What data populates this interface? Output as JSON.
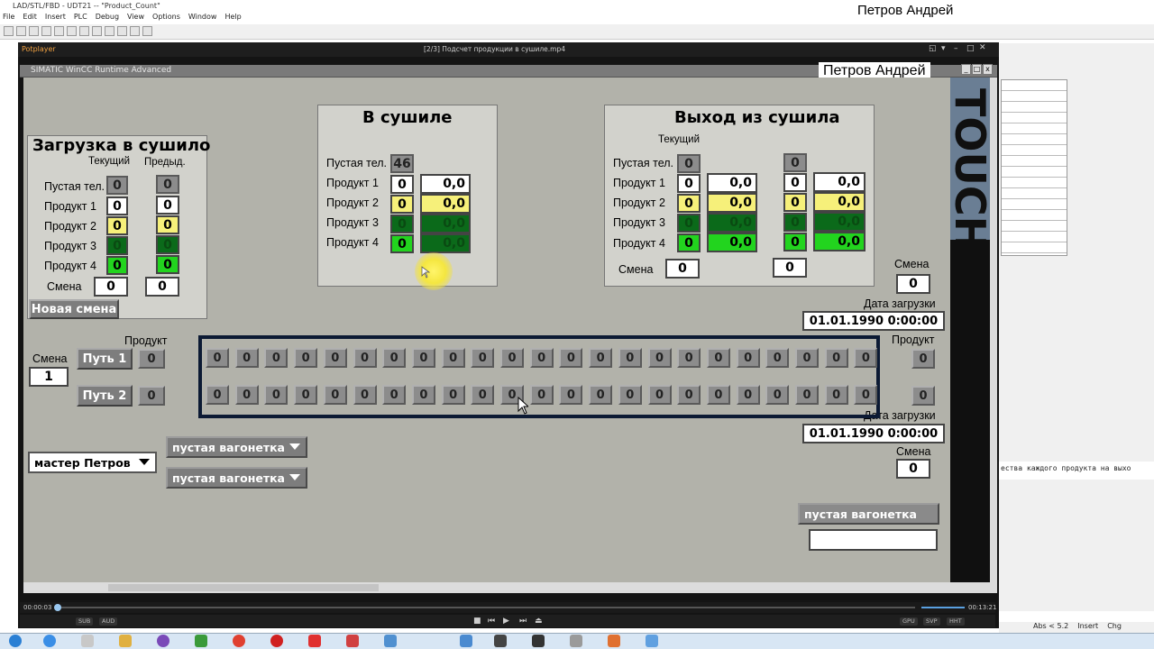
{
  "editor": {
    "title": "LAD/STL/FBD - UDT21 -- \"Product_Count\"",
    "menu": [
      "File",
      "Edit",
      "Insert",
      "PLC",
      "Debug",
      "View",
      "Options",
      "Window",
      "Help"
    ]
  },
  "watermark_name": "Петров Андрей",
  "player": {
    "app": "Potplayer",
    "file": "[2/3] Подсчет продукции в сушиле.mp4",
    "time_current": "00:00:03",
    "time_total": "00:13:21",
    "progress_percent": 0.4,
    "buttons": [
      "SUB",
      "AUD"
    ],
    "right_buttons": [
      "GPU",
      "SVP",
      "HHT"
    ]
  },
  "wincc": {
    "title": "SIMATIC WinCC Runtime Advanced",
    "brand_strip": "TOUCH"
  },
  "loading": {
    "title": "Загрузка в сушило",
    "col_current": "Текущий",
    "col_prev": "Предыд.",
    "rows": [
      {
        "label": "Пустая тел.",
        "current": "0",
        "prev": "0"
      },
      {
        "label": "Продукт 1",
        "current": "0",
        "prev": "0"
      },
      {
        "label": "Продукт 2",
        "current": "0",
        "prev": "0"
      },
      {
        "label": "Продукт 3",
        "current": "0",
        "prev": "0"
      },
      {
        "label": "Продукт 4",
        "current": "0",
        "prev": "0"
      }
    ],
    "shift_label": "Смена",
    "shift_current": "0",
    "shift_prev": "0",
    "new_shift_button": "Новая смена"
  },
  "dryer": {
    "title": "В сушиле",
    "rows": [
      {
        "label": "Пустая тел.",
        "count": "46",
        "amount": ""
      },
      {
        "label": "Продукт 1",
        "count": "0",
        "amount": "0,0"
      },
      {
        "label": "Продукт 2",
        "count": "0",
        "amount": "0,0"
      },
      {
        "label": "Продукт 3",
        "count": "0",
        "amount": "0,0"
      },
      {
        "label": "Продукт 4",
        "count": "0",
        "amount": "0,0"
      }
    ]
  },
  "exit": {
    "title": "Выход из сушила",
    "col_current": "Текущий",
    "rows": [
      {
        "label": "Пустая тел.",
        "count1": "0",
        "amount1": "",
        "count2": "0",
        "amount2": ""
      },
      {
        "label": "Продукт 1",
        "count1": "0",
        "amount1": "0,0",
        "count2": "0",
        "amount2": "0,0"
      },
      {
        "label": "Продукт 2",
        "count1": "0",
        "amount1": "0,0",
        "count2": "0",
        "amount2": "0,0"
      },
      {
        "label": "Продукт 3",
        "count1": "0",
        "amount1": "0,0",
        "count2": "0",
        "amount2": "0,0"
      },
      {
        "label": "Продукт 4",
        "count1": "0",
        "amount1": "0,0",
        "count2": "0",
        "amount2": "0,0"
      }
    ],
    "shift_label": "Смена",
    "shift1": "0",
    "shift2": "0"
  },
  "right_side": {
    "shift_label_top": "Смена",
    "shift_top": "0",
    "date_label_top": "Дата загрузки",
    "date_top": "01.01.1990 0:00:00",
    "product_label": "Продукт",
    "product1": "0",
    "product2": "0",
    "date_label_bottom": "Дата загрузки",
    "date_bottom": "01.01.1990 0:00:00",
    "shift_label_bottom": "Смена",
    "shift_bottom": "0",
    "cart_button": "пустая вагонетка",
    "cart_field": ""
  },
  "tracks": {
    "shift_label": "Смена",
    "shift_value": "1",
    "product_label": "Продукт",
    "path1_button": "Путь 1",
    "path1_product": "0",
    "path2_button": "Путь 2",
    "path2_product": "0",
    "path1_cells": [
      "0",
      "0",
      "0",
      "0",
      "0",
      "0",
      "0",
      "0",
      "0",
      "0",
      "0",
      "0",
      "0",
      "0",
      "0",
      "0",
      "0",
      "0",
      "0",
      "0",
      "0",
      "0",
      "0"
    ],
    "path2_cells": [
      "0",
      "0",
      "0",
      "0",
      "0",
      "0",
      "0",
      "0",
      "0",
      "0",
      "0",
      "0",
      "0",
      "0",
      "0",
      "0",
      "0",
      "0",
      "0",
      "0",
      "0",
      "0",
      "0"
    ]
  },
  "operator": {
    "master_select": "мастер Петров",
    "cart1": "пустая вагонетка",
    "cart2": "пустая вагонетка"
  },
  "background_editor": {
    "code_snippet": "ества каждого продукта на выхо",
    "status": [
      "Abs < 5.2",
      "Insert",
      "Chg"
    ]
  },
  "colors": {
    "hmi_bg": "#b2b2aa",
    "yellow": "#f6f07a",
    "dark_green": "#0b6a1a",
    "green": "#22d41e",
    "track_border": "#0c1a34"
  }
}
